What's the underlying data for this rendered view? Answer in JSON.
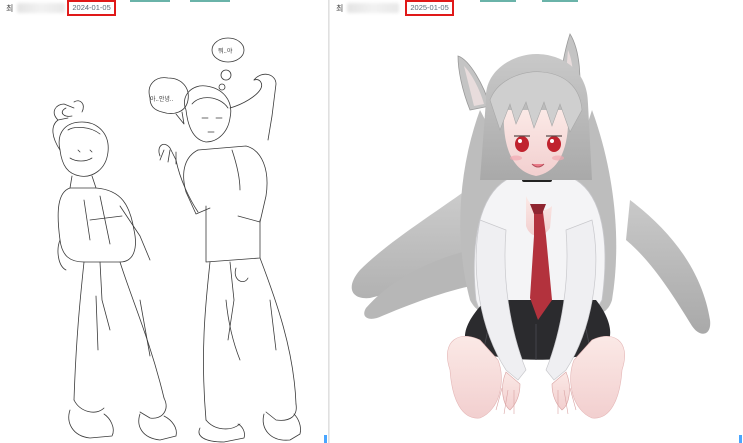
{
  "left_window": {
    "title_initial": "최",
    "date_label": "2024-01-05",
    "speech_bubble_1": "아..안녕..",
    "speech_bubble_2": "뭐..야"
  },
  "right_window": {
    "title_initial": "최",
    "date_label": "2025-01-05"
  },
  "colors": {
    "highlight_border": "#e01919",
    "date_text": "#5a6b7a",
    "sketch_line": "#3a3a3a",
    "hair": "#bcbcbc",
    "skirt": "#2b2b2e",
    "tie": "#b3323d",
    "eyes": "#c0232e"
  }
}
